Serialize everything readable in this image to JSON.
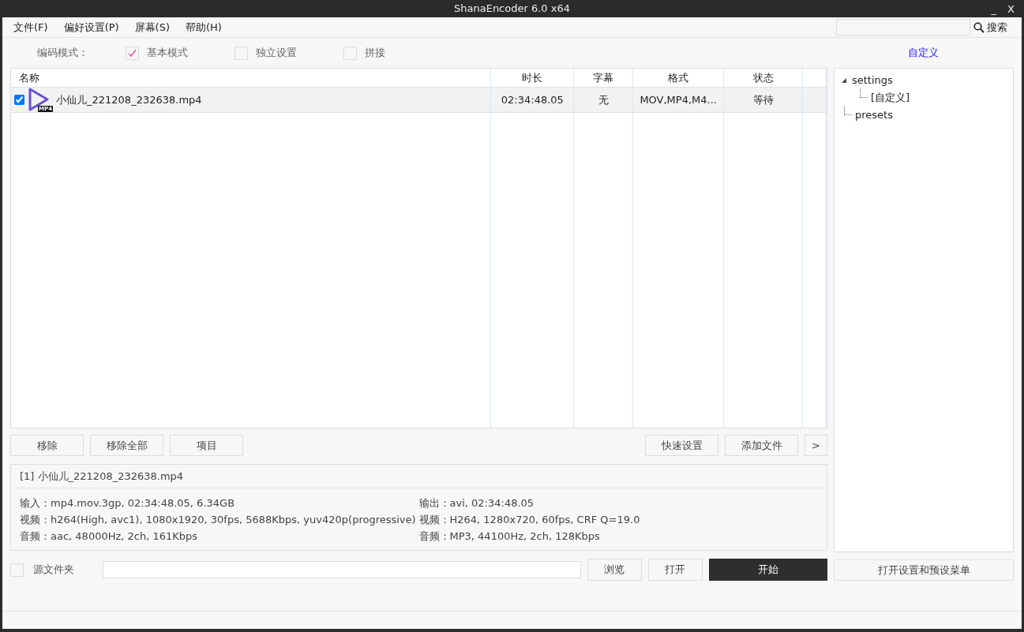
{
  "window": {
    "title": "ShanaEncoder 6.0 x64",
    "controls": [
      "_",
      "X"
    ]
  },
  "menu": [
    "文件(F)",
    "偏好设置(P)",
    "屏幕(S)",
    "帮助(H)"
  ],
  "search": {
    "button": "搜索"
  },
  "mode": {
    "label": "编码模式：",
    "options": [
      {
        "label": "基本模式",
        "checked": true
      },
      {
        "label": "独立设置",
        "checked": false
      },
      {
        "label": "拼接",
        "checked": false
      }
    ]
  },
  "preset_link": "自定义",
  "table": {
    "columns": [
      "名称",
      "时长",
      "字幕",
      "格式",
      "状态"
    ],
    "rows": [
      {
        "checked": true,
        "selected": true,
        "badge": "MP4",
        "name": "小仙儿_221208_232638.mp4",
        "duration": "02:34:48.05",
        "subtitle": "无",
        "format": "MOV,MP4,M4...",
        "status": "等待"
      }
    ]
  },
  "tree": [
    {
      "label": "settings",
      "expanded": true,
      "children": [
        {
          "label": "[自定义]"
        }
      ]
    },
    {
      "label": "presets"
    }
  ],
  "left_buttons": [
    "移除",
    "移除全部",
    "项目"
  ],
  "right_buttons": [
    "快速设置",
    "添加文件",
    ">"
  ],
  "info": {
    "title": "[1] 小仙儿_221208_232638.mp4",
    "input": [
      "输入：mp4.mov.3gp, 02:34:48.05, 6.34GB",
      "视频：h264(High, avc1), 1080x1920, 30fps, 5688Kbps,  yuv420p(progressive)",
      "音频：aac, 48000Hz, 2ch, 161Kbps"
    ],
    "output": [
      "输出：avi, 02:34:48.05",
      "视频：H264, 1280x720, 60fps, CRF Q=19.0",
      "音频：MP3, 44100Hz, 2ch, 128Kbps"
    ]
  },
  "source_folder": {
    "label": "源文件夹",
    "checked": false
  },
  "bottom_buttons": [
    {
      "label": "浏览",
      "kind": "normal"
    },
    {
      "label": "打开",
      "kind": "normal"
    },
    {
      "label": "开始",
      "kind": "primary"
    }
  ],
  "settings_button": "打开设置和预设菜单"
}
